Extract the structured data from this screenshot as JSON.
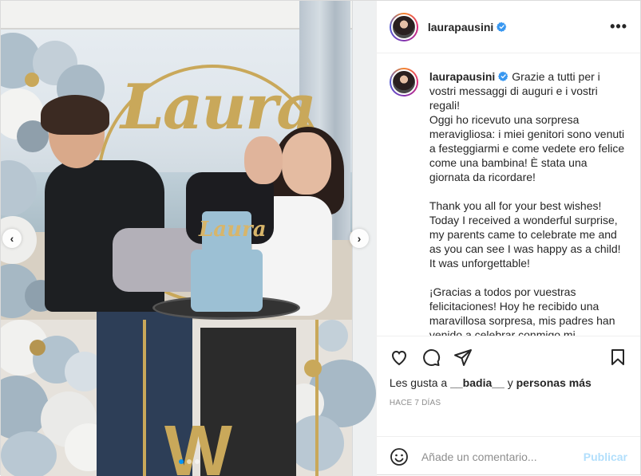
{
  "post": {
    "username": "laurapausini",
    "verified": true,
    "more_label": "•••",
    "caption_paragraphs": [
      "Grazie a tutti per i vostri messaggi di auguri e i vostri regali!",
      "Oggi ho ricevuto una sorpresa meravigliosa: i miei genitori sono venuti a festeggiarmi e come vedete ero felice come una bambina! È stata una giornata da ricordare!",
      "Thank you all for your best wishes! Today I received a wonderful surprise, my parents came to celebrate me and as you can see I was happy as a child! It was unforgettable!",
      "¡Gracias a todos por vuestras felicitaciones! Hoy he recibido una maravillosa sorpresa, mis padres han venido a celebrar conmigo mi cumpleaños y como podéis ver soy"
    ],
    "likes_prefix": "Les gusta a",
    "likes_user": "__badia__",
    "likes_connector": "y",
    "likes_others": "personas más",
    "timestamp": "HACE 7 DÍAS",
    "comment_placeholder": "Añade un comentario...",
    "publish_label": "Publicar"
  },
  "media": {
    "sign_text": "Laura",
    "cake_topper_text": "Laura",
    "stand_letter": "W",
    "carousel_total": 3,
    "carousel_active": 1
  },
  "icons": {
    "like": "heart-icon",
    "comment": "comment-bubble-icon",
    "share": "paper-plane-icon",
    "save": "bookmark-icon",
    "emoji": "smiley-icon",
    "verified": "verified-badge-icon",
    "prev": "chevron-left-icon",
    "next": "chevron-right-icon"
  },
  "colors": {
    "accent_blue": "#0095f6",
    "publish_disabled": "#b2dffc",
    "verified_blue": "#3897f0",
    "cake_blue": "#9cc0d4",
    "gold": "#c9a85a"
  }
}
